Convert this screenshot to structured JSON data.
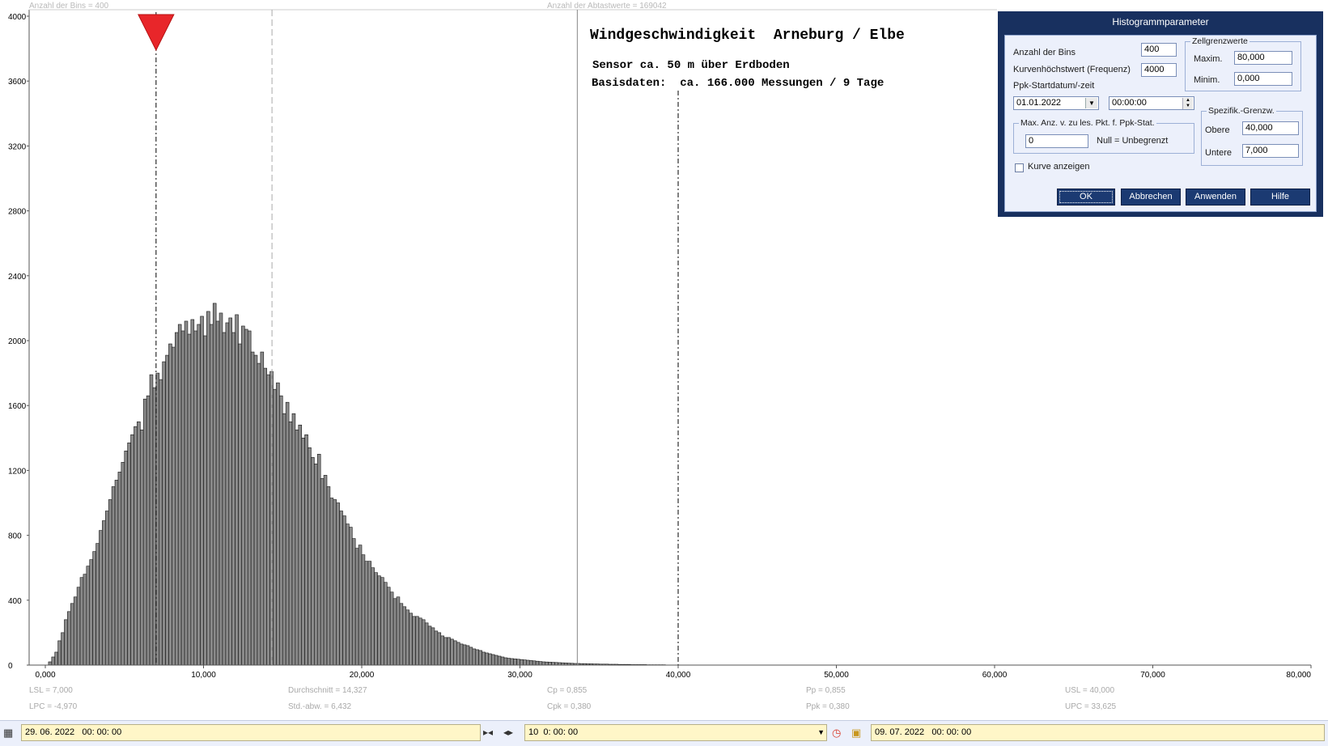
{
  "top_info": {
    "bins_text": "Anzahl der Bins = 400",
    "samples_text": "Anzahl der Abtastwerte = 169042"
  },
  "chart_title": {
    "line1": "Windgeschwindigkeit  Arneburg / Elbe",
    "line2": "Sensor ca. 50 m über Erdboden",
    "line3": "Basisdaten:  ca. 166.000 Messungen / 9 Tage"
  },
  "stats": {
    "lsl": "LSL = 7,000",
    "lpc": "LPC = -4,970",
    "mean": "Durchschnitt = 14,327",
    "std": "Std.-abw. = 6,432",
    "cp": "Cp = 0,855",
    "cpk": "Cpk = 0,380",
    "pp": "Pp = 0,855",
    "ppk": "Ppk = 0,380",
    "usl": "USL = 40,000",
    "upc": "UPC = 33,625"
  },
  "chart_data": {
    "type": "bar",
    "title": "Windgeschwindigkeit  Arneburg / Elbe",
    "xlim": [
      0,
      80
    ],
    "ylim": [
      0,
      4000
    ],
    "x_ticks": [
      "0,000",
      "10,000",
      "20,000",
      "30,000",
      "40,000",
      "50,000",
      "60,000",
      "70,000",
      "80,000"
    ],
    "y_ticks": [
      "0",
      "400",
      "800",
      "1200",
      "1600",
      "2000",
      "2400",
      "2800",
      "3200",
      "3600",
      "4000"
    ],
    "bin_width": 0.2,
    "bin_start": 0,
    "values": [
      0,
      20,
      50,
      80,
      150,
      200,
      280,
      330,
      380,
      420,
      480,
      540,
      560,
      610,
      650,
      700,
      750,
      830,
      890,
      950,
      1020,
      1100,
      1140,
      1190,
      1250,
      1320,
      1370,
      1420,
      1470,
      1500,
      1450,
      1640,
      1660,
      1790,
      1710,
      1800,
      1760,
      1870,
      1910,
      1980,
      1960,
      2050,
      2100,
      2060,
      2120,
      2040,
      2130,
      2060,
      2100,
      2150,
      2030,
      2180,
      2100,
      2230,
      2120,
      2170,
      2050,
      2110,
      2140,
      2050,
      2160,
      1980,
      2090,
      2070,
      2060,
      1930,
      1910,
      1860,
      1930,
      1830,
      1790,
      1810,
      1700,
      1740,
      1660,
      1550,
      1620,
      1500,
      1550,
      1450,
      1480,
      1400,
      1420,
      1340,
      1280,
      1240,
      1300,
      1150,
      1170,
      1100,
      1030,
      1020,
      1000,
      950,
      920,
      870,
      850,
      780,
      720,
      740,
      680,
      640,
      640,
      600,
      570,
      550,
      540,
      510,
      480,
      450,
      410,
      420,
      380,
      360,
      340,
      320,
      300,
      300,
      290,
      280,
      260,
      240,
      230,
      210,
      200,
      180,
      170,
      170,
      160,
      150,
      140,
      130,
      125,
      120,
      110,
      100,
      95,
      90,
      80,
      75,
      70,
      65,
      60,
      55,
      50,
      45,
      42,
      40,
      38,
      36,
      34,
      32,
      30,
      28,
      26,
      24,
      22,
      20,
      19,
      18,
      17,
      16,
      15,
      14,
      13,
      12,
      11,
      10,
      10,
      9,
      9,
      8,
      8,
      7,
      7,
      6,
      6,
      6,
      5,
      5,
      5,
      4,
      4,
      4,
      4,
      3,
      3,
      3,
      3,
      3,
      2,
      2,
      2,
      2,
      2,
      2
    ],
    "lines": {
      "lsl": 7.0,
      "mean": 14.327,
      "usl": 40.0,
      "mid": 33.625
    },
    "grid": false
  },
  "dialog": {
    "title": "Histogrammparameter",
    "bins_label": "Anzahl der Bins",
    "bins_value": "400",
    "curvemax_label": "Kurvenhöchstwert (Frequenz)",
    "curvemax_value": "4000",
    "ppk_label": "Ppk-Startdatum/-zeit",
    "ppk_date": "01.01.2022",
    "ppk_time": "00:00:00",
    "max_group_label": "Max. Anz. v. zu les. Pkt. f. Ppk-Stat.",
    "max_value": "0",
    "null_label": "Null = Unbegrenzt",
    "cell_group_label": "Zellgrenzwerte",
    "maxim_label": "Maxim.",
    "maxim_value": "80,000",
    "minim_label": "Minim.",
    "minim_value": "0,000",
    "spec_group_label": "Spezifik.-Grenzw.",
    "obere_label": "Obere",
    "obere_value": "40,000",
    "untere_label": "Untere",
    "untere_value": "7,000",
    "curve_checkbox_label": "Kurve anzeigen",
    "btn_ok": "OK",
    "btn_cancel": "Abbrechen",
    "btn_apply": "Anwenden",
    "btn_help": "Hilfe"
  },
  "toolbar": {
    "start_date": "29. 06. 2022   00: 00: 00",
    "interval": "10  0: 00: 00",
    "end_date": "09. 07. 2022   00: 00: 00"
  }
}
